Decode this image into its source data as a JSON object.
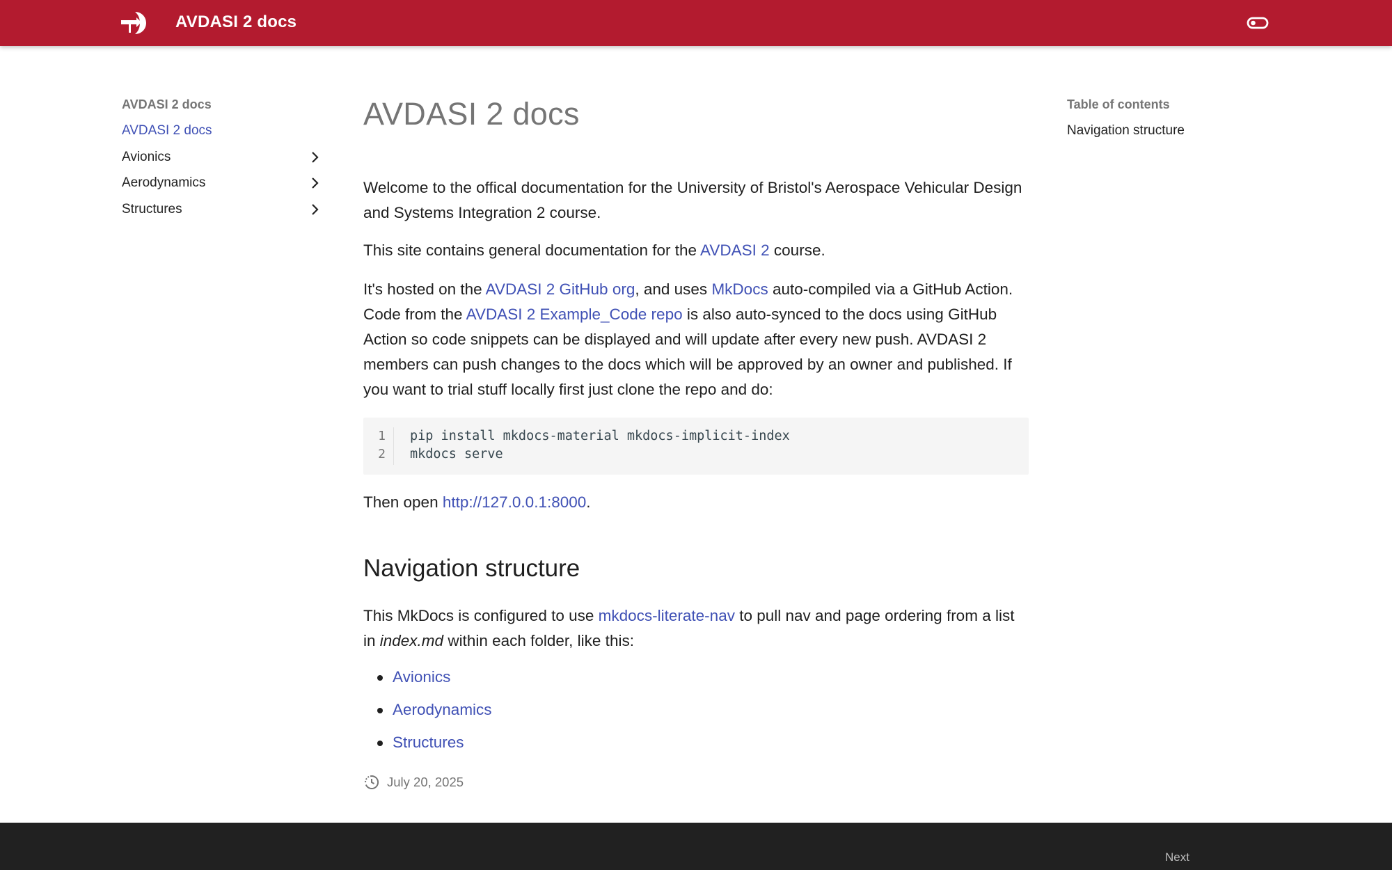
{
  "header": {
    "site_title": "AVDASI 2 docs",
    "logo_icon": "arrow-logo-icon",
    "toggle_icon": "toggle-switch-icon",
    "brand_color": "#b31b2f"
  },
  "left_nav": {
    "title": "AVDASI 2 docs",
    "items": [
      {
        "label": "AVDASI 2 docs",
        "active": true
      },
      {
        "label": "Avionics",
        "has_children": true
      },
      {
        "label": "Aerodynamics",
        "has_children": true
      },
      {
        "label": "Structures",
        "has_children": true
      }
    ],
    "accent_color": "#4051b5"
  },
  "toc": {
    "title": "Table of contents",
    "items": [
      {
        "label": "Navigation structure"
      }
    ]
  },
  "main": {
    "title": "AVDASI 2 docs",
    "intro": "Welcome to the offical documentation for the University of Bristol's Aerospace Vehicular Design and Systems Integration 2 course.",
    "p2": {
      "before": "This site contains general documentation for the ",
      "link": "AVDASI 2",
      "after": " course."
    },
    "p3": {
      "t1": "It's hosted on the ",
      "link1": "AVDASI 2 GitHub org",
      "t2": ", and uses ",
      "link2": "MkDocs",
      "t3": " auto-compiled via a GitHub Action. Code from the ",
      "link3": "AVDASI 2 Example_Code repo",
      "t4": " is also auto-synced to the docs using GitHub Action so code snippets can be displayed and will update after every new push. AVDASI 2 members can push changes to the docs which will be approved by an owner and published. If you want to trial stuff locally first just clone the repo and do:"
    },
    "code": {
      "line_numbers": [
        "1",
        "2"
      ],
      "lines": [
        "pip install mkdocs-material mkdocs-implicit-index",
        "mkdocs serve"
      ]
    },
    "p4": {
      "before": "Then open ",
      "link": "http://127.0.0.1:8000",
      "after": "."
    },
    "section_title": "Navigation structure",
    "p5": {
      "t1": "This MkDocs is configured to use ",
      "link": "mkdocs-literate-nav",
      "t2": " to pull nav and page ordering from a list in ",
      "em": "index.md",
      "t3": " within each folder, like this:"
    },
    "list": [
      "Avionics",
      "Aerodynamics",
      "Structures"
    ],
    "updated": {
      "icon": "clock-history-icon",
      "date": "July 20, 2025"
    }
  },
  "footer": {
    "next_label": "Next"
  }
}
